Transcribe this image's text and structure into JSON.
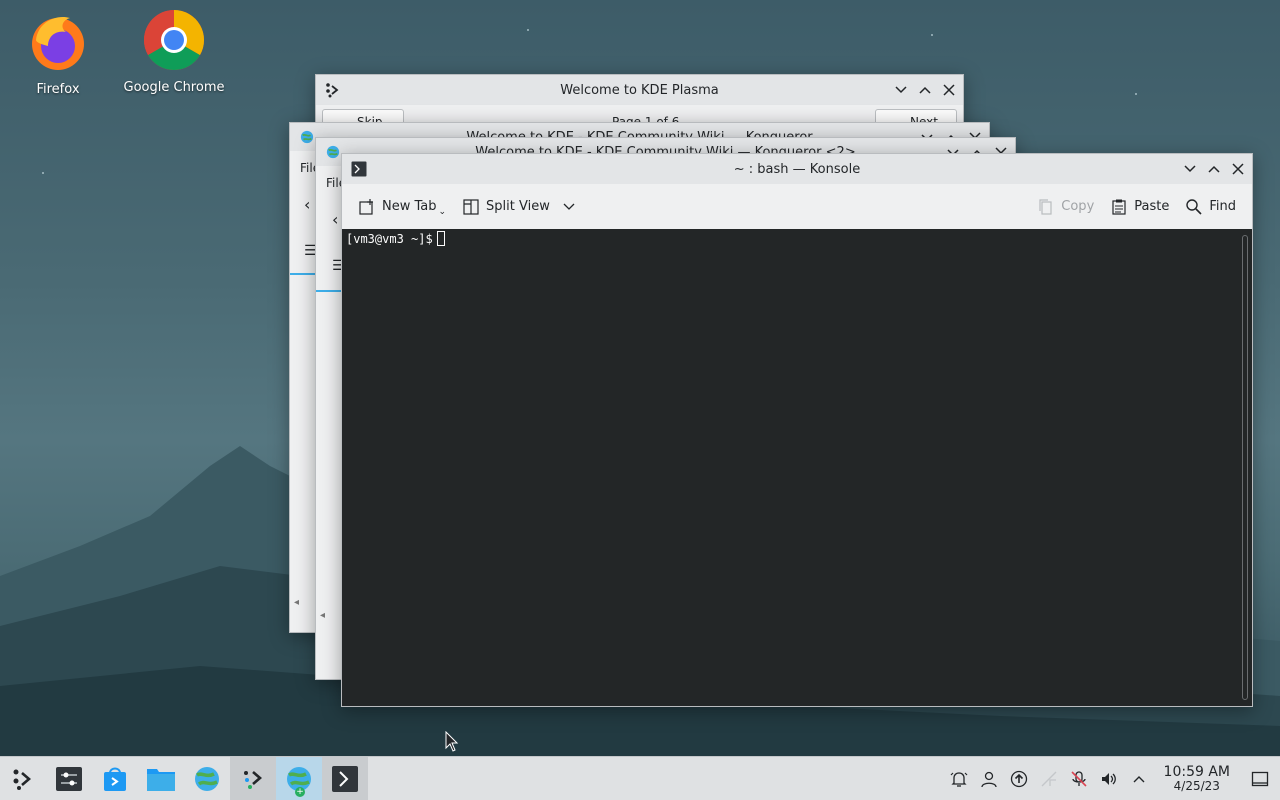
{
  "desktop": {
    "icons": [
      {
        "label": "Firefox"
      },
      {
        "label": "Google Chrome"
      }
    ]
  },
  "windows": {
    "welcome": {
      "title": "Welcome to KDE Plasma",
      "partial_btn_left": "Skip",
      "partial_btn_right": "Next",
      "page_indicator": "Page 1 of 6"
    },
    "konq1": {
      "title": "Welcome to KDE - KDE Community Wiki — Konqueror",
      "menu_partial": "File"
    },
    "konq2": {
      "title": "Welcome to KDE - KDE Community Wiki — Konqueror <2>",
      "menu_partial": "File"
    },
    "konsole": {
      "title": "~ : bash — Konsole",
      "toolbar": {
        "new_tab": "New Tab",
        "split_view": "Split View",
        "copy": "Copy",
        "paste": "Paste",
        "find": "Find"
      },
      "prompt": "[vm3@vm3 ~]$"
    }
  },
  "taskbar": {
    "clock": {
      "time": "10:59 AM",
      "date": "4/25/23"
    }
  },
  "colors": {
    "accent": "#3daee9",
    "terminal_bg": "#232627"
  }
}
